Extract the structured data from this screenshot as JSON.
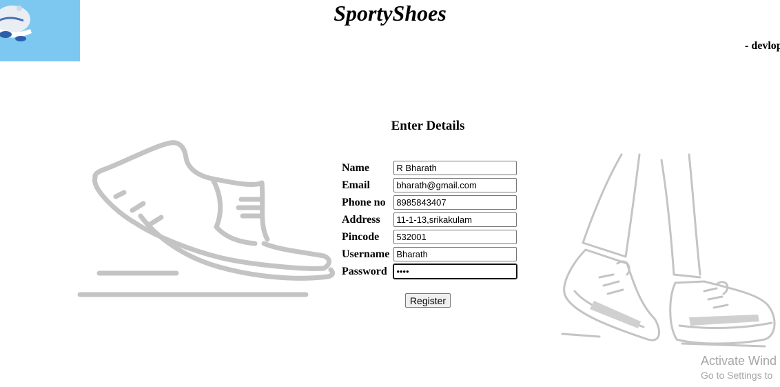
{
  "header": {
    "title": "SportyShoes",
    "developer_note": "- devlop"
  },
  "form": {
    "heading": "Enter Details",
    "fields": [
      {
        "label": "Name",
        "type": "text",
        "value": "R Bharath"
      },
      {
        "label": "Email",
        "type": "text",
        "value": "bharath@gmail.com"
      },
      {
        "label": "Phone no",
        "type": "text",
        "value": "8985843407"
      },
      {
        "label": "Address",
        "type": "text",
        "value": "11-1-13,srikakulam"
      },
      {
        "label": "Pincode",
        "type": "text",
        "value": "532001"
      },
      {
        "label": "Username",
        "type": "text",
        "value": "Bharath"
      },
      {
        "label": "Password",
        "type": "password",
        "value": "••••"
      }
    ],
    "submit_label": "Register"
  },
  "watermark": {
    "line1": "Activate Wind",
    "line2": "Go to Settings to"
  },
  "colors": {
    "logo_background": "#7cc8f1",
    "illustration_gray": "#c4c4c4",
    "watermark_text": "#a6a6a6"
  },
  "icons": [
    "sneaker-logo-icon",
    "running-shoe-icon",
    "walking-legs-icon"
  ]
}
